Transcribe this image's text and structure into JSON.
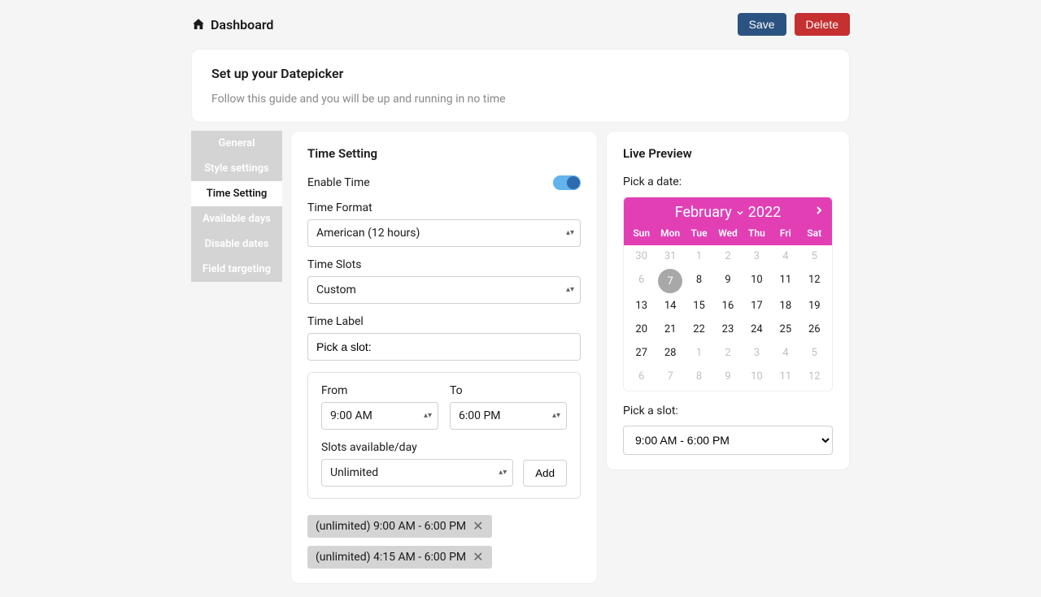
{
  "header": {
    "title": "Dashboard",
    "save": "Save",
    "delete": "Delete"
  },
  "intro": {
    "title": "Set up your Datepicker",
    "subtitle": "Follow this guide and you will be up and running in no time"
  },
  "sidebar": {
    "items": [
      {
        "label": "General"
      },
      {
        "label": "Style settings"
      },
      {
        "label": "Time Setting"
      },
      {
        "label": "Available days"
      },
      {
        "label": "Disable dates"
      },
      {
        "label": "Field targeting"
      }
    ],
    "active_index": 2
  },
  "settings": {
    "title": "Time Setting",
    "enable_label": "Enable Time",
    "enable_value": true,
    "format_label": "Time Format",
    "format_value": "American (12 hours)",
    "slots_label": "Time Slots",
    "slots_value": "Custom",
    "timelabel_label": "Time Label",
    "timelabel_value": "Pick a slot:",
    "from_label": "From",
    "from_value": "9:00 AM",
    "to_label": "To",
    "to_value": "6:00 PM",
    "avail_label": "Slots available/day",
    "avail_value": "Unlimited",
    "add_label": "Add",
    "chips": [
      {
        "text": "(unlimited) 9:00 AM - 6:00 PM"
      },
      {
        "text": "(unlimited) 4:15 AM - 6:00 PM"
      }
    ]
  },
  "preview": {
    "title": "Live Preview",
    "pick_date_label": "Pick a date:",
    "pick_slot_label": "Pick a slot:",
    "month": "February",
    "year": "2022",
    "weekdays": [
      "Sun",
      "Mon",
      "Tue",
      "Wed",
      "Thu",
      "Fri",
      "Sat"
    ],
    "days": [
      {
        "n": "30",
        "out": true
      },
      {
        "n": "31",
        "out": true
      },
      {
        "n": "1",
        "out": true
      },
      {
        "n": "2",
        "out": true
      },
      {
        "n": "3",
        "out": true
      },
      {
        "n": "4",
        "out": true
      },
      {
        "n": "5",
        "out": true
      },
      {
        "n": "6",
        "out": true
      },
      {
        "n": "7",
        "sel": true
      },
      {
        "n": "8"
      },
      {
        "n": "9"
      },
      {
        "n": "10"
      },
      {
        "n": "11"
      },
      {
        "n": "12"
      },
      {
        "n": "13"
      },
      {
        "n": "14"
      },
      {
        "n": "15"
      },
      {
        "n": "16"
      },
      {
        "n": "17"
      },
      {
        "n": "18"
      },
      {
        "n": "19"
      },
      {
        "n": "20"
      },
      {
        "n": "21"
      },
      {
        "n": "22"
      },
      {
        "n": "23"
      },
      {
        "n": "24"
      },
      {
        "n": "25"
      },
      {
        "n": "26"
      },
      {
        "n": "27"
      },
      {
        "n": "28"
      },
      {
        "n": "1",
        "out": true
      },
      {
        "n": "2",
        "out": true
      },
      {
        "n": "3",
        "out": true
      },
      {
        "n": "4",
        "out": true
      },
      {
        "n": "5",
        "out": true
      },
      {
        "n": "6",
        "out": true
      },
      {
        "n": "7",
        "out": true
      },
      {
        "n": "8",
        "out": true
      },
      {
        "n": "9",
        "out": true
      },
      {
        "n": "10",
        "out": true
      },
      {
        "n": "11",
        "out": true
      },
      {
        "n": "12",
        "out": true
      }
    ],
    "slot_value": "9:00 AM - 6:00 PM"
  }
}
